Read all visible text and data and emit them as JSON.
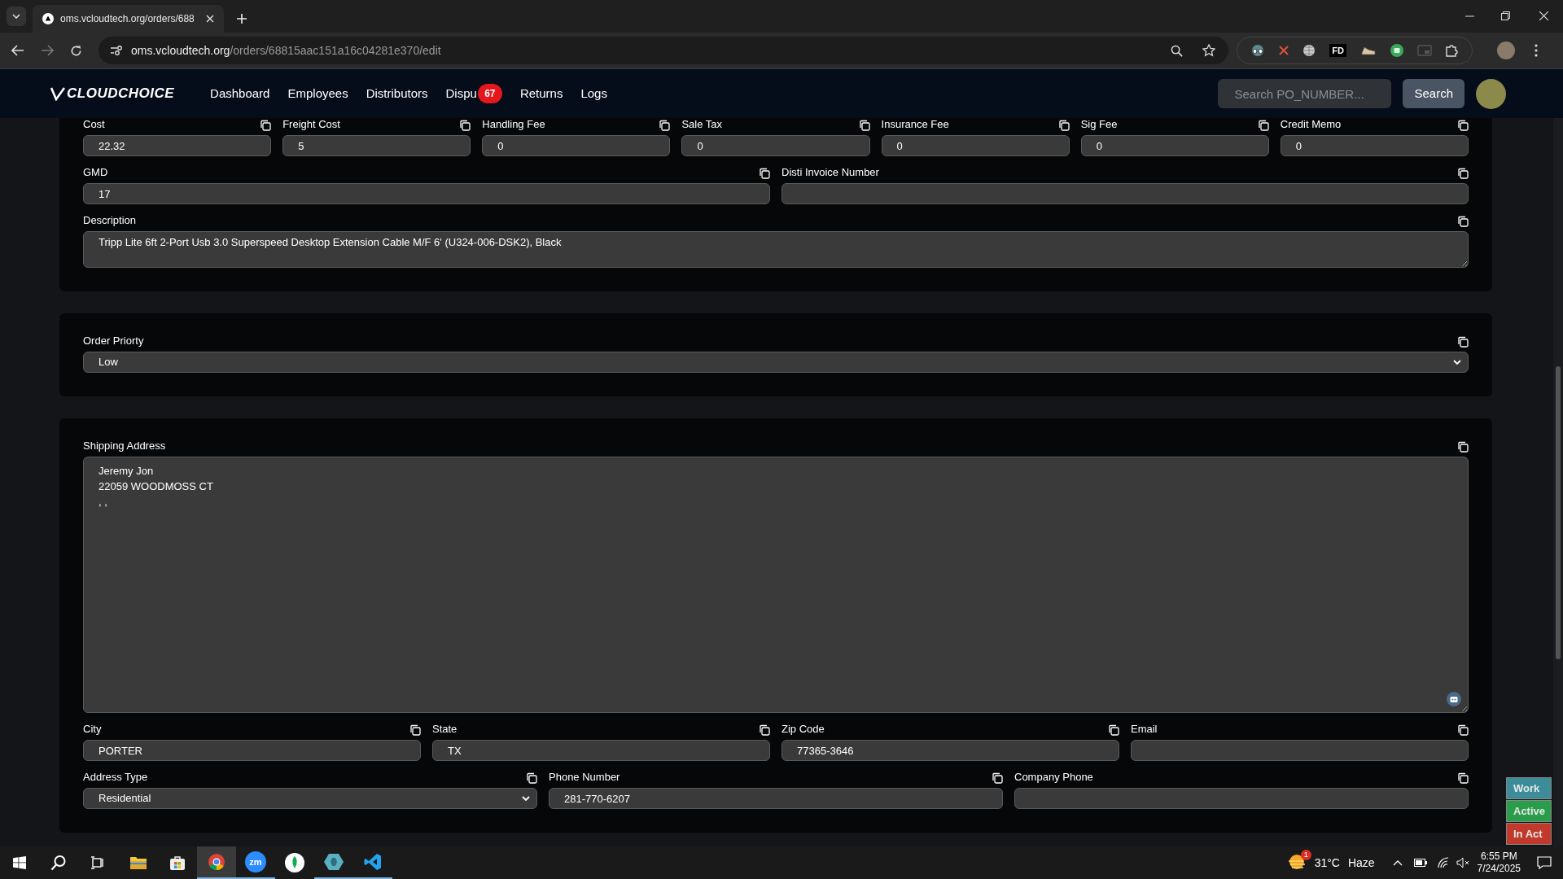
{
  "browser": {
    "tab_title": "oms.vcloudtech.org/orders/688",
    "url_host": "oms.vcloudtech.org",
    "url_path": "/orders/68815aac151a16c04281e370/edit",
    "extension_label": "FD"
  },
  "nav": {
    "logo": "CLOUDCHOICE",
    "items": [
      {
        "label": "Dashboard"
      },
      {
        "label": "Employees"
      },
      {
        "label": "Distributors"
      },
      {
        "label": "Dispu",
        "badge": "67"
      },
      {
        "label": "Returns"
      },
      {
        "label": "Logs"
      }
    ],
    "search": {
      "placeholder": "Search PO_NUMBER..."
    },
    "search_button": "Search"
  },
  "sections": [
    {
      "rows": [
        [
          {
            "label": "Cost",
            "value": "22.32",
            "kind": "input"
          },
          {
            "label": "Freight Cost",
            "value": "5",
            "kind": "input"
          },
          {
            "label": "Handling Fee",
            "value": "0",
            "kind": "input"
          },
          {
            "label": "Sale Tax",
            "value": "0",
            "kind": "input"
          },
          {
            "label": "Insurance Fee",
            "value": "0",
            "kind": "input"
          },
          {
            "label": "Sig Fee",
            "value": "0",
            "kind": "input"
          },
          {
            "label": "Credit Memo",
            "value": "0",
            "kind": "input"
          }
        ],
        [
          {
            "label": "GMD",
            "value": "17",
            "kind": "input"
          },
          {
            "label": "Disti Invoice Number",
            "kind": "input"
          }
        ],
        [
          {
            "label": "Description",
            "value": "Tripp Lite 6ft 2-Port Usb 3.0 Superspeed Desktop Extension Cable M/F 6' (U324-006-DSK2), Black",
            "kind": "textarea"
          }
        ]
      ]
    },
    {
      "rows": [
        [
          {
            "label": "Order Priorty",
            "value": "Low",
            "kind": "select"
          }
        ]
      ]
    },
    {
      "rows": [
        [
          {
            "label": "Shipping Address",
            "value": "Jeremy Jon\n22059 WOODMOSS CT\n, ,",
            "kind": "address"
          }
        ],
        [
          {
            "label": "City",
            "value": "PORTER",
            "kind": "input"
          },
          {
            "label": "State",
            "value": "TX",
            "kind": "input"
          },
          {
            "label": "Zip Code",
            "value": "77365-3646",
            "kind": "input"
          },
          {
            "label": "Email",
            "kind": "input"
          }
        ],
        [
          {
            "label": "Address Type",
            "value": "Residential",
            "kind": "select"
          },
          {
            "label": "Phone Number",
            "value": "281-770-6207",
            "kind": "input"
          },
          {
            "label": "Company Phone",
            "kind": "input"
          }
        ]
      ]
    }
  ],
  "status_badges": [
    {
      "label": "Work",
      "color": "#3c8d99"
    },
    {
      "label": "Active",
      "color": "#2a9d4a"
    },
    {
      "label": "In Act",
      "color": "#c0392b"
    }
  ],
  "taskbar": {
    "zoom_label": "zm",
    "weather_alert": "1",
    "temperature": "31°C",
    "weather": "Haze",
    "time": "6:55 PM",
    "date": "7/24/2025"
  }
}
